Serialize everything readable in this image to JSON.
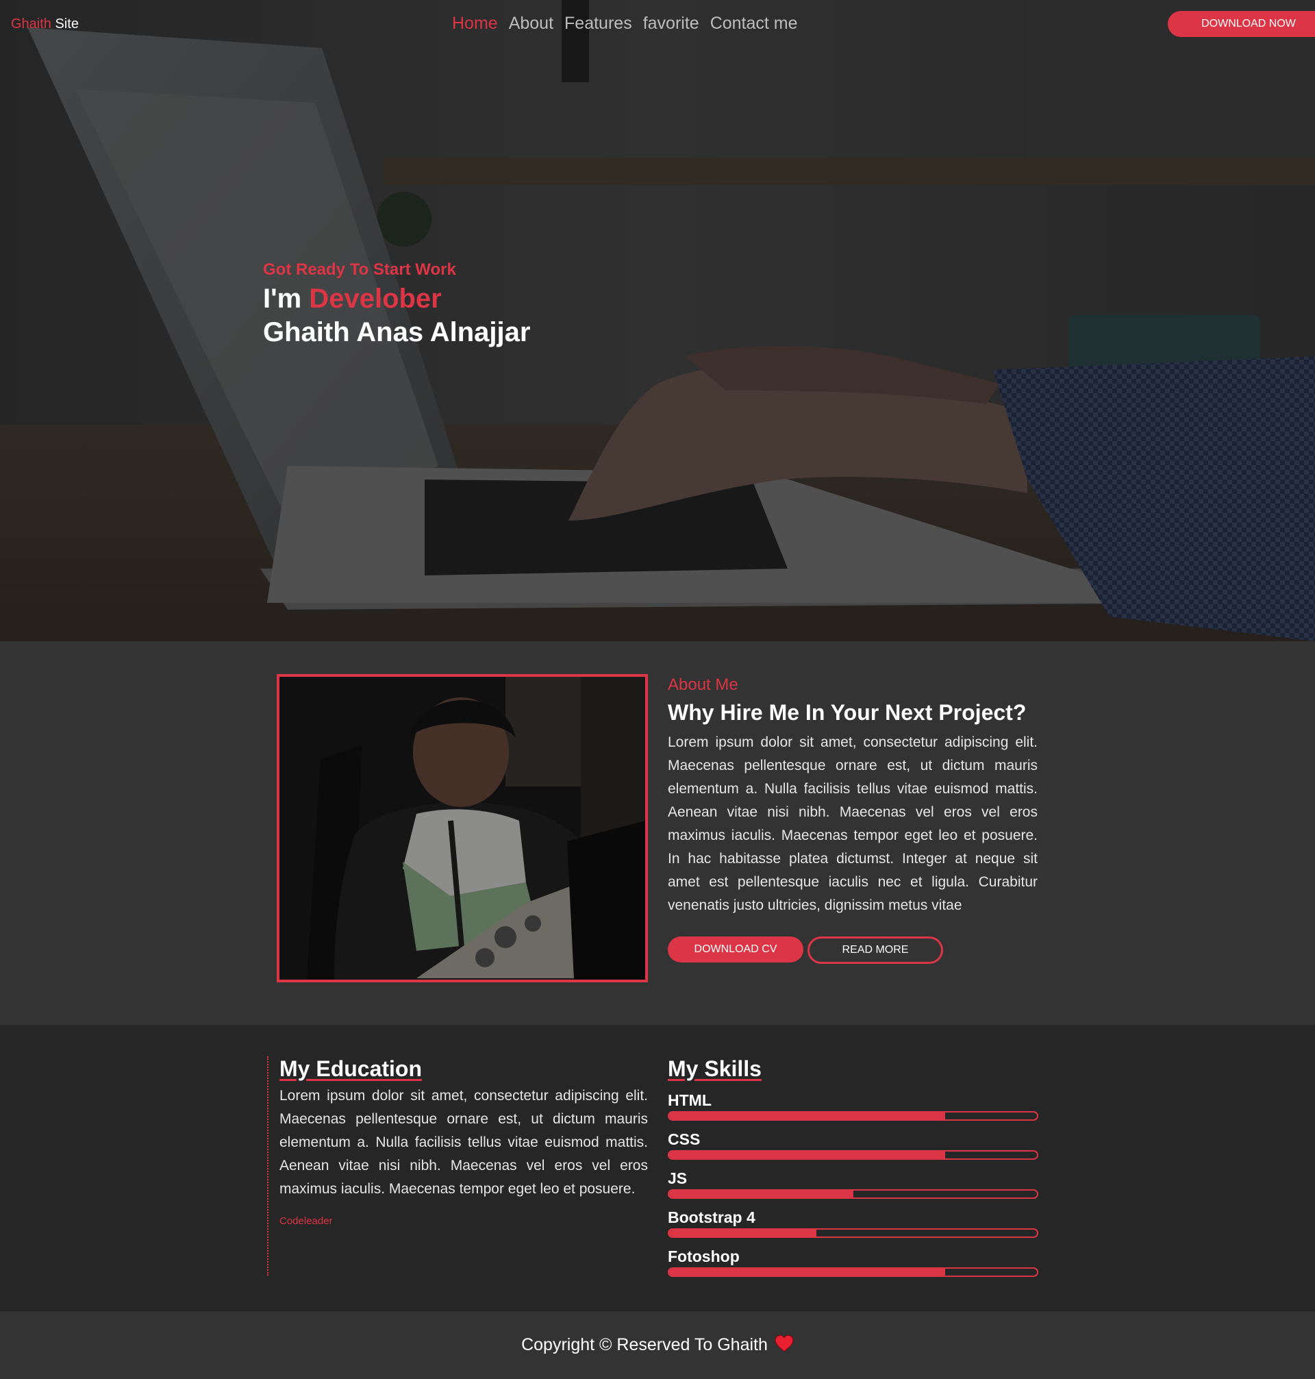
{
  "nav": {
    "brand_accent": "Ghaith",
    "brand_rest": "Site",
    "links": [
      "Home",
      "About",
      "Features",
      "favorite",
      "Contact me"
    ],
    "cta_label": "DOWNLOAD NOW"
  },
  "hero": {
    "eyebrow": "Got Ready To Start Work",
    "line1_prefix": "I'm",
    "line1_accent": "Develober",
    "line2": "Ghaith Anas Alnajjar"
  },
  "about": {
    "eyebrow": "About Me",
    "title": "Why Hire Me In Your Next Project?",
    "paragraph": "Lorem ipsum dolor sit amet, consectetur adipiscing elit. Maecenas pellentesque ornare est, ut dictum mauris elementum a. Nulla facilisis tellus vitae euismod mattis. Aenean vitae nisi nibh. Maecenas vel eros vel eros maximus iaculis. Maecenas tempor eget leo et posuere. In hac habitasse platea dictumst. Integer at neque sit amet est pellentesque iaculis nec et ligula. Curabitur venenatis justo ultricies, dignissim metus vitae",
    "btn_cv": "DOWNLOAD CV",
    "btn_read": "READ MORE"
  },
  "education": {
    "title": "My Education",
    "paragraph": "Lorem ipsum dolor sit amet, consectetur adipiscing elit. Maecenas pellentesque ornare est, ut dictum mauris elementum a. Nulla facilisis tellus vitae euismod mattis. Aenean vitae nisi nibh. Maecenas vel eros vel eros maximus iaculis. Maecenas tempor eget leo et posuere.",
    "footnote": "Codeleader"
  },
  "skills": {
    "title": "My Skills",
    "items": [
      {
        "name": "HTML",
        "level": 0.75
      },
      {
        "name": "CSS",
        "level": 0.75
      },
      {
        "name": "JS",
        "level": 0.5
      },
      {
        "name": "Bootstrap 4",
        "level": 0.4
      },
      {
        "name": "Fotoshop",
        "level": 0.75
      }
    ]
  },
  "footer": {
    "text": "Copyright © Reserved To Ghaith"
  },
  "colors": {
    "accent": "#dc3545"
  }
}
